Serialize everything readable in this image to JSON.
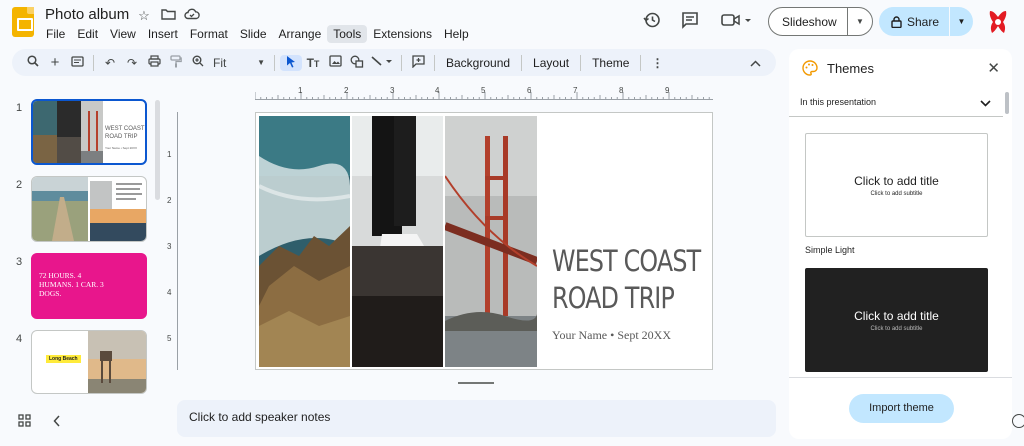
{
  "header": {
    "doc_title": "Photo album",
    "menu": [
      "File",
      "Edit",
      "View",
      "Insert",
      "Format",
      "Slide",
      "Arrange",
      "Tools",
      "Extensions",
      "Help"
    ],
    "active_menu": "Tools",
    "slideshow_label": "Slideshow",
    "share_label": "Share"
  },
  "toolbar": {
    "zoom": "Fit",
    "background_label": "Background",
    "layout_label": "Layout",
    "theme_label": "Theme"
  },
  "filmstrip": {
    "slides": [
      {
        "num": "1",
        "title": "WEST COAST ROAD TRIP",
        "sub": "Your Name • Sept 20XX"
      },
      {
        "num": "2"
      },
      {
        "num": "3",
        "text": "72 HOURS. 4 HUMANS. 1 CAR. 3 DOGS."
      },
      {
        "num": "4",
        "label": "Long Beach"
      }
    ]
  },
  "ruler": {
    "h_marks": [
      "1",
      "2",
      "3",
      "4",
      "5",
      "6",
      "7",
      "8",
      "9"
    ],
    "v_marks": [
      "1",
      "2",
      "3",
      "4",
      "5"
    ]
  },
  "slide": {
    "title_line1": "WEST COAST",
    "title_line2": "ROAD TRIP",
    "subtitle": "Your Name • Sept 20XX"
  },
  "notes": {
    "placeholder": "Click to add speaker notes"
  },
  "themes": {
    "panel_title": "Themes",
    "section": "In this presentation",
    "cards": [
      {
        "title": "Click to add title",
        "subtitle": "Click to add subtitle",
        "name": "Simple Light"
      },
      {
        "title": "Click to add title",
        "subtitle": "Click to add subtitle"
      }
    ],
    "import_label": "Import theme"
  },
  "colors": {
    "accent": "#0b57d0",
    "share_bg": "#c2e7ff",
    "slide3_bg": "#e8168c",
    "app_logo": "#f4b400"
  }
}
